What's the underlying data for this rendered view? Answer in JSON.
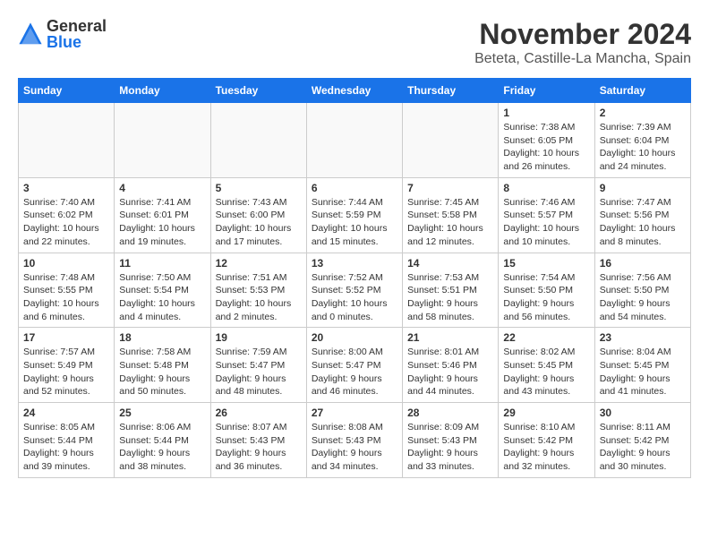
{
  "header": {
    "logo_general": "General",
    "logo_blue": "Blue",
    "month": "November 2024",
    "location": "Beteta, Castille-La Mancha, Spain"
  },
  "weekdays": [
    "Sunday",
    "Monday",
    "Tuesday",
    "Wednesday",
    "Thursday",
    "Friday",
    "Saturday"
  ],
  "weeks": [
    [
      {
        "day": "",
        "info": ""
      },
      {
        "day": "",
        "info": ""
      },
      {
        "day": "",
        "info": ""
      },
      {
        "day": "",
        "info": ""
      },
      {
        "day": "",
        "info": ""
      },
      {
        "day": "1",
        "info": "Sunrise: 7:38 AM\nSunset: 6:05 PM\nDaylight: 10 hours and 26 minutes."
      },
      {
        "day": "2",
        "info": "Sunrise: 7:39 AM\nSunset: 6:04 PM\nDaylight: 10 hours and 24 minutes."
      }
    ],
    [
      {
        "day": "3",
        "info": "Sunrise: 7:40 AM\nSunset: 6:02 PM\nDaylight: 10 hours and 22 minutes."
      },
      {
        "day": "4",
        "info": "Sunrise: 7:41 AM\nSunset: 6:01 PM\nDaylight: 10 hours and 19 minutes."
      },
      {
        "day": "5",
        "info": "Sunrise: 7:43 AM\nSunset: 6:00 PM\nDaylight: 10 hours and 17 minutes."
      },
      {
        "day": "6",
        "info": "Sunrise: 7:44 AM\nSunset: 5:59 PM\nDaylight: 10 hours and 15 minutes."
      },
      {
        "day": "7",
        "info": "Sunrise: 7:45 AM\nSunset: 5:58 PM\nDaylight: 10 hours and 12 minutes."
      },
      {
        "day": "8",
        "info": "Sunrise: 7:46 AM\nSunset: 5:57 PM\nDaylight: 10 hours and 10 minutes."
      },
      {
        "day": "9",
        "info": "Sunrise: 7:47 AM\nSunset: 5:56 PM\nDaylight: 10 hours and 8 minutes."
      }
    ],
    [
      {
        "day": "10",
        "info": "Sunrise: 7:48 AM\nSunset: 5:55 PM\nDaylight: 10 hours and 6 minutes."
      },
      {
        "day": "11",
        "info": "Sunrise: 7:50 AM\nSunset: 5:54 PM\nDaylight: 10 hours and 4 minutes."
      },
      {
        "day": "12",
        "info": "Sunrise: 7:51 AM\nSunset: 5:53 PM\nDaylight: 10 hours and 2 minutes."
      },
      {
        "day": "13",
        "info": "Sunrise: 7:52 AM\nSunset: 5:52 PM\nDaylight: 10 hours and 0 minutes."
      },
      {
        "day": "14",
        "info": "Sunrise: 7:53 AM\nSunset: 5:51 PM\nDaylight: 9 hours and 58 minutes."
      },
      {
        "day": "15",
        "info": "Sunrise: 7:54 AM\nSunset: 5:50 PM\nDaylight: 9 hours and 56 minutes."
      },
      {
        "day": "16",
        "info": "Sunrise: 7:56 AM\nSunset: 5:50 PM\nDaylight: 9 hours and 54 minutes."
      }
    ],
    [
      {
        "day": "17",
        "info": "Sunrise: 7:57 AM\nSunset: 5:49 PM\nDaylight: 9 hours and 52 minutes."
      },
      {
        "day": "18",
        "info": "Sunrise: 7:58 AM\nSunset: 5:48 PM\nDaylight: 9 hours and 50 minutes."
      },
      {
        "day": "19",
        "info": "Sunrise: 7:59 AM\nSunset: 5:47 PM\nDaylight: 9 hours and 48 minutes."
      },
      {
        "day": "20",
        "info": "Sunrise: 8:00 AM\nSunset: 5:47 PM\nDaylight: 9 hours and 46 minutes."
      },
      {
        "day": "21",
        "info": "Sunrise: 8:01 AM\nSunset: 5:46 PM\nDaylight: 9 hours and 44 minutes."
      },
      {
        "day": "22",
        "info": "Sunrise: 8:02 AM\nSunset: 5:45 PM\nDaylight: 9 hours and 43 minutes."
      },
      {
        "day": "23",
        "info": "Sunrise: 8:04 AM\nSunset: 5:45 PM\nDaylight: 9 hours and 41 minutes."
      }
    ],
    [
      {
        "day": "24",
        "info": "Sunrise: 8:05 AM\nSunset: 5:44 PM\nDaylight: 9 hours and 39 minutes."
      },
      {
        "day": "25",
        "info": "Sunrise: 8:06 AM\nSunset: 5:44 PM\nDaylight: 9 hours and 38 minutes."
      },
      {
        "day": "26",
        "info": "Sunrise: 8:07 AM\nSunset: 5:43 PM\nDaylight: 9 hours and 36 minutes."
      },
      {
        "day": "27",
        "info": "Sunrise: 8:08 AM\nSunset: 5:43 PM\nDaylight: 9 hours and 34 minutes."
      },
      {
        "day": "28",
        "info": "Sunrise: 8:09 AM\nSunset: 5:43 PM\nDaylight: 9 hours and 33 minutes."
      },
      {
        "day": "29",
        "info": "Sunrise: 8:10 AM\nSunset: 5:42 PM\nDaylight: 9 hours and 32 minutes."
      },
      {
        "day": "30",
        "info": "Sunrise: 8:11 AM\nSunset: 5:42 PM\nDaylight: 9 hours and 30 minutes."
      }
    ]
  ]
}
